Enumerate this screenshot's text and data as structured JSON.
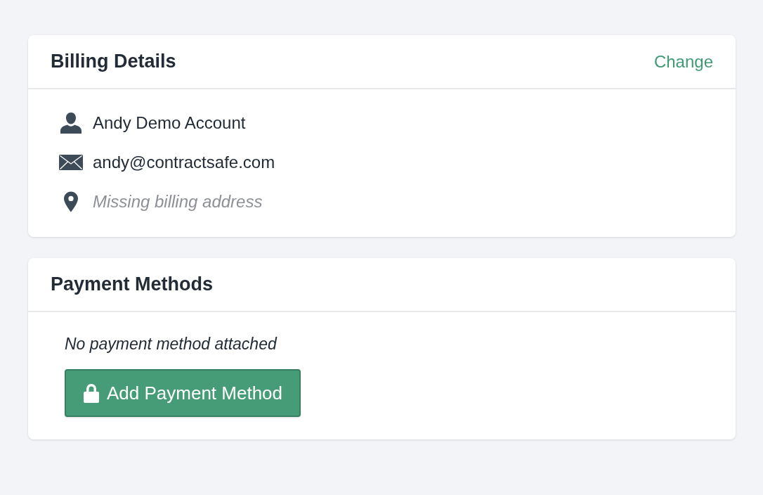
{
  "billing_details": {
    "title": "Billing Details",
    "action": "Change",
    "rows": [
      {
        "kind": "person",
        "text": "Andy Demo Account",
        "missing": false
      },
      {
        "kind": "email",
        "text": "andy@contractsafe.com",
        "missing": false
      },
      {
        "kind": "address",
        "text": "Missing billing address",
        "missing": true
      }
    ]
  },
  "payment_methods": {
    "title": "Payment Methods",
    "empty_message": "No payment method attached",
    "button": "Add Payment Method"
  }
}
